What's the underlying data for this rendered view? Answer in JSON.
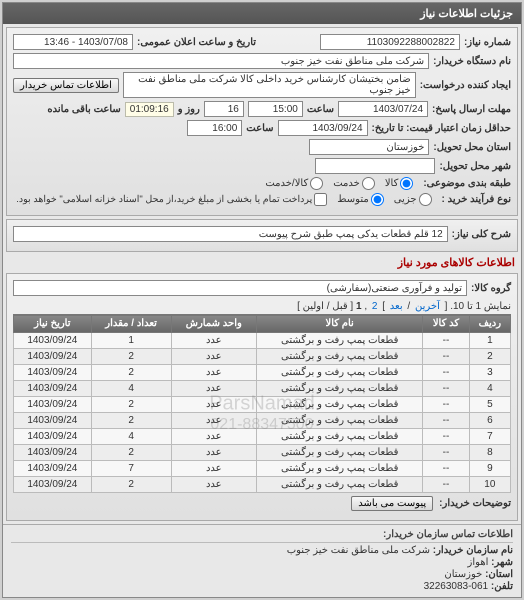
{
  "header": {
    "title": "جزئیات اطلاعات نیاز"
  },
  "fields": {
    "need_no_label": "شماره نیاز:",
    "need_no": "1103092288002822",
    "announce_label": "تاریخ و ساعت اعلان عمومی:",
    "announce_value": "1403/07/08 - 13:46",
    "buyer_label": "نام دستگاه خریدار:",
    "buyer_value": "شرکت ملی مناطق نفت خیز جنوب",
    "creator_label": "ایجاد کننده درخواست:",
    "creator_value": "ضامن  بختیشان  کارشناس خرید داخلی کالا   شرکت ملی مناطق نفت خیز جنوب",
    "contact_btn": "اطلاعات تماس خریدار",
    "reply_deadline_label": "مهلت ارسال پاسخ:",
    "reply_to_label": "تا تاریخ:",
    "reply_date": "1403/07/24",
    "time_label": "ساعت",
    "reply_time": "15:00",
    "days_remaining": "16",
    "days_label": "روز و",
    "countdown": "01:09:16",
    "remain_label": "ساعت باقی مانده",
    "price_validity_label": "حداقل زمان اعتبار قیمت: تا تاریخ:",
    "price_date": "1403/09/24",
    "price_time": "16:00",
    "province_label": "استان محل تحویل:",
    "province_value": "خوزستان",
    "city_label": "شهر محل تحویل:",
    "city_value": "",
    "category_label": "طبقه بندی موضوعی:",
    "cat_all": "کالا",
    "cat_service": "خدمت",
    "cat_both": "کالا/خدمت",
    "process_label": "نوع فرآیند خرید :",
    "proc_tender": "جزیی",
    "proc_medium": "متوسط",
    "payment_note": "پرداخت تمام یا بخشی از مبلغ خرید،از محل \"اسناد خزانه اسلامی\" خواهد بود.",
    "need_title_label": "شرح کلی نیاز:",
    "need_title_value": "12 قلم قطعات یدکی پمپ طبق شرح پیوست",
    "items_header": "اطلاعات کالاهای مورد نیاز",
    "group_label": "گروه کالا:",
    "group_value": "تولید و فرآوری صنعتی(سفارشی)",
    "pager_range": "نمایش 1 تا 10.",
    "pager_last": "آخرین",
    "pager_next": "بعد",
    "pager_prev": "قبل",
    "pager_first": "اولین",
    "attachments_label": "توضیحات خریدار:",
    "attachments_btn": "پیوست می باشد"
  },
  "table": {
    "cols": [
      "ردیف",
      "کد کالا",
      "نام کالا",
      "واحد شمارش",
      "تعداد / مقدار",
      "تاریخ نیاز"
    ],
    "rows": [
      [
        "1",
        "--",
        "قطعات پمپ رفت و برگشتی",
        "عدد",
        "1",
        "1403/09/24"
      ],
      [
        "2",
        "--",
        "قطعات پمپ رفت و برگشتی",
        "عدد",
        "2",
        "1403/09/24"
      ],
      [
        "3",
        "--",
        "قطعات پمپ رفت و برگشتی",
        "عدد",
        "2",
        "1403/09/24"
      ],
      [
        "4",
        "--",
        "قطعات پمپ رفت و برگشتی",
        "عدد",
        "4",
        "1403/09/24"
      ],
      [
        "5",
        "--",
        "قطعات پمپ رفت و برگشتی",
        "عدد",
        "2",
        "1403/09/24"
      ],
      [
        "6",
        "--",
        "قطعات پمپ رفت و برگشتی",
        "عدد",
        "2",
        "1403/09/24"
      ],
      [
        "7",
        "--",
        "قطعات پمپ رفت و برگشتی",
        "عدد",
        "4",
        "1403/09/24"
      ],
      [
        "8",
        "--",
        "قطعات پمپ رفت و برگشتی",
        "عدد",
        "2",
        "1403/09/24"
      ],
      [
        "9",
        "--",
        "قطعات پمپ رفت و برگشتی",
        "عدد",
        "7",
        "1403/09/24"
      ],
      [
        "10",
        "--",
        "قطعات پمپ رفت و برگشتی",
        "عدد",
        "2",
        "1403/09/24"
      ]
    ]
  },
  "watermark": {
    "line1": "ParsNamad",
    "line2": "سامانه مناقصه و مزایده ایران",
    "line3": "021-88347500"
  },
  "org": {
    "header": "اطلاعات تماس سازمان خریدار:",
    "name_label": "نام سازمان خریدار:",
    "name_value": "شرکت ملی مناطق نفت خیز جنوب",
    "city_label": "شهر:",
    "city_value": "اهواز",
    "province_label": "استان:",
    "province_value": "خوزستان",
    "tel_label": "تلفن:",
    "tel_value": "32263083-061"
  }
}
